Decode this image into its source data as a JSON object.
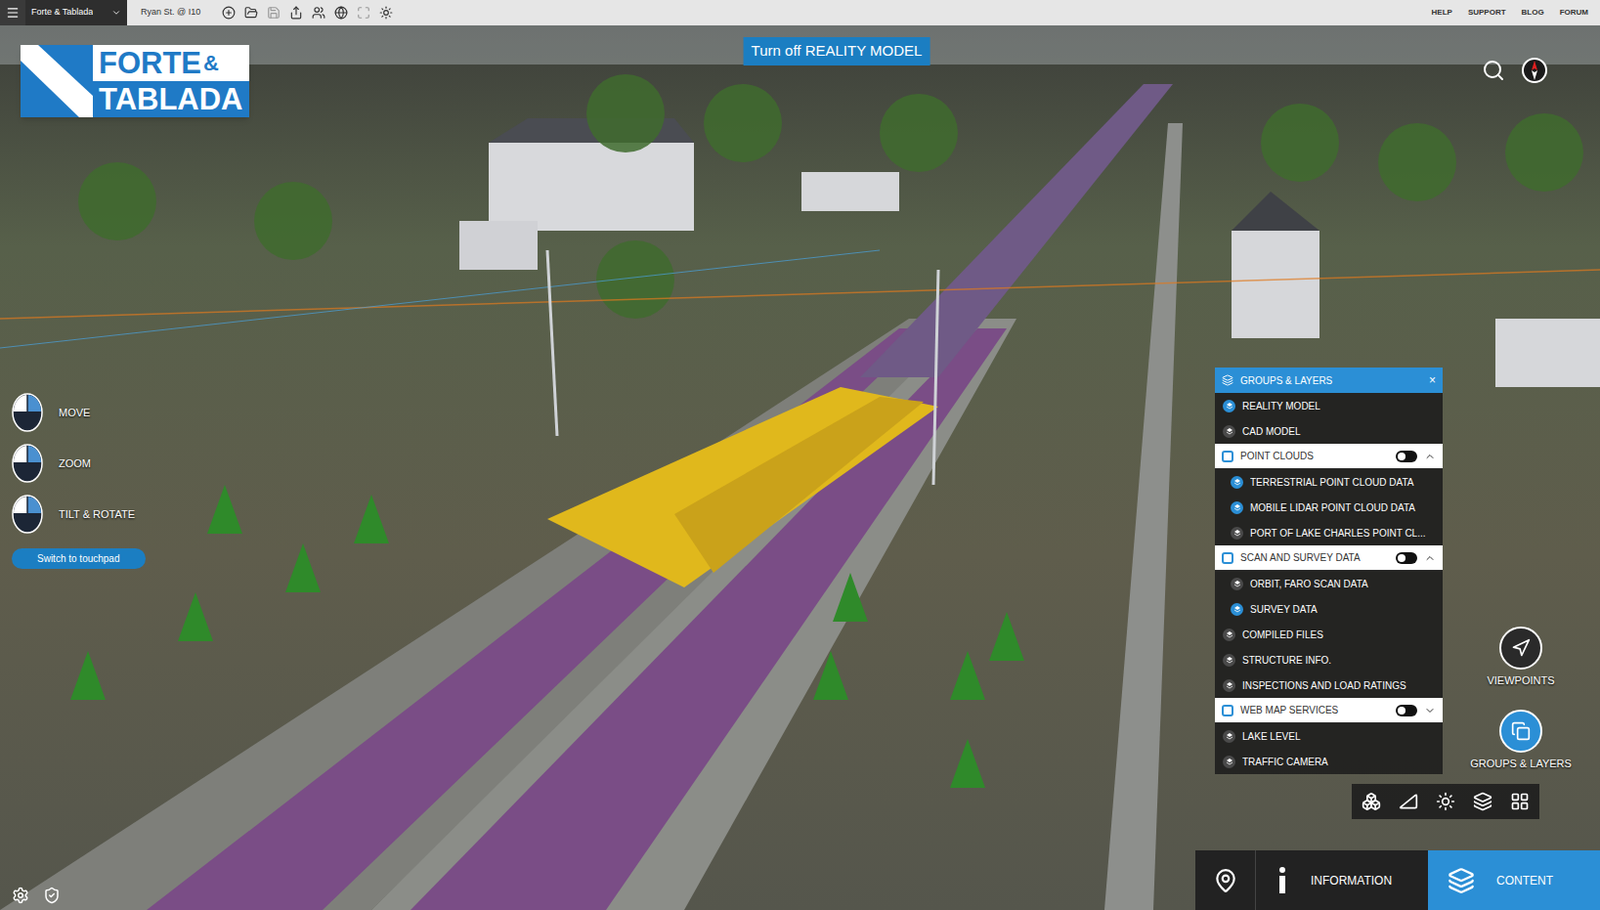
{
  "top_bar": {
    "project_dropdown": "Forte & Tablada",
    "location": "Ryan St. @ I10",
    "links": [
      "HELP",
      "SUPPORT",
      "BLOG",
      "FORUM"
    ]
  },
  "logo": {
    "word1": "FORTE",
    "ampersand": "&",
    "word2": "TABLADA"
  },
  "banner": "Turn off REALITY MODEL",
  "navigation_hints": [
    {
      "label": "MOVE"
    },
    {
      "label": "ZOOM"
    },
    {
      "label": "TILT & ROTATE"
    }
  ],
  "touchpad_button": "Switch to touchpad",
  "layers_panel": {
    "title": "GROUPS & LAYERS",
    "close": "×",
    "rows": [
      {
        "label": "REALITY MODEL",
        "kind": "layer",
        "on": true
      },
      {
        "label": "CAD MODEL",
        "kind": "layer",
        "on": false
      },
      {
        "label": "POINT CLOUDS",
        "kind": "group",
        "on": false,
        "expanded": true
      },
      {
        "label": "TERRESTRIAL POINT CLOUD DATA",
        "kind": "sublayer",
        "on": true
      },
      {
        "label": "MOBILE LIDAR POINT CLOUD DATA",
        "kind": "sublayer",
        "on": true
      },
      {
        "label": "PORT OF LAKE CHARLES POINT CL...",
        "kind": "sublayer",
        "on": false
      },
      {
        "label": "SCAN AND SURVEY DATA",
        "kind": "group",
        "on": false,
        "expanded": true
      },
      {
        "label": "ORBIT, FARO SCAN DATA",
        "kind": "sublayer",
        "on": false
      },
      {
        "label": "SURVEY DATA",
        "kind": "sublayer",
        "on": true
      },
      {
        "label": "COMPILED FILES",
        "kind": "layer",
        "on": false
      },
      {
        "label": "STRUCTURE INFO.",
        "kind": "layer",
        "on": false
      },
      {
        "label": "INSPECTIONS AND LOAD RATINGS",
        "kind": "layer",
        "on": false
      },
      {
        "label": "WEB MAP SERVICES",
        "kind": "group",
        "on": false,
        "expanded": false
      },
      {
        "label": "LAKE LEVEL",
        "kind": "layer",
        "on": false
      },
      {
        "label": "TRAFFIC CAMERA",
        "kind": "layer",
        "on": false
      }
    ]
  },
  "side_buttons": [
    {
      "label": "VIEWPOINTS",
      "selected": false
    },
    {
      "label": "GROUPS & LAYERS",
      "selected": true
    }
  ],
  "bottom_tabs": [
    {
      "label": "INFORMATION",
      "selected": false
    },
    {
      "label": "CONTENT",
      "selected": true
    }
  ]
}
